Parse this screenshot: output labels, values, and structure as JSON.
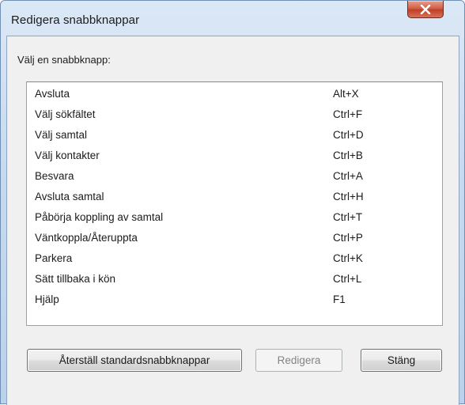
{
  "window": {
    "title": "Redigera snabbknappar"
  },
  "prompt": "Välj en snabbknapp:",
  "shortcuts": [
    {
      "command": "Avsluta",
      "key": "Alt+X"
    },
    {
      "command": "Välj sökfältet",
      "key": "Ctrl+F"
    },
    {
      "command": "Välj samtal",
      "key": "Ctrl+D"
    },
    {
      "command": "Välj kontakter",
      "key": "Ctrl+B"
    },
    {
      "command": "Besvara",
      "key": "Ctrl+A"
    },
    {
      "command": "Avsluta samtal",
      "key": "Ctrl+H"
    },
    {
      "command": "Påbörja koppling av samtal",
      "key": "Ctrl+T"
    },
    {
      "command": "Väntkoppla/Återuppta",
      "key": "Ctrl+P"
    },
    {
      "command": "Parkera",
      "key": "Ctrl+K"
    },
    {
      "command": "Sätt tillbaka i kön",
      "key": "Ctrl+L"
    },
    {
      "command": "Hjälp",
      "key": "F1"
    }
  ],
  "buttons": {
    "reset_label": "Återställ standardsnabbknappar",
    "edit_label": "Redigera",
    "edit_enabled": false,
    "close_label": "Stäng"
  },
  "icons": {
    "close": "close-icon"
  },
  "colors": {
    "close_button": "#c94a33",
    "disabled_text": "#838383"
  }
}
